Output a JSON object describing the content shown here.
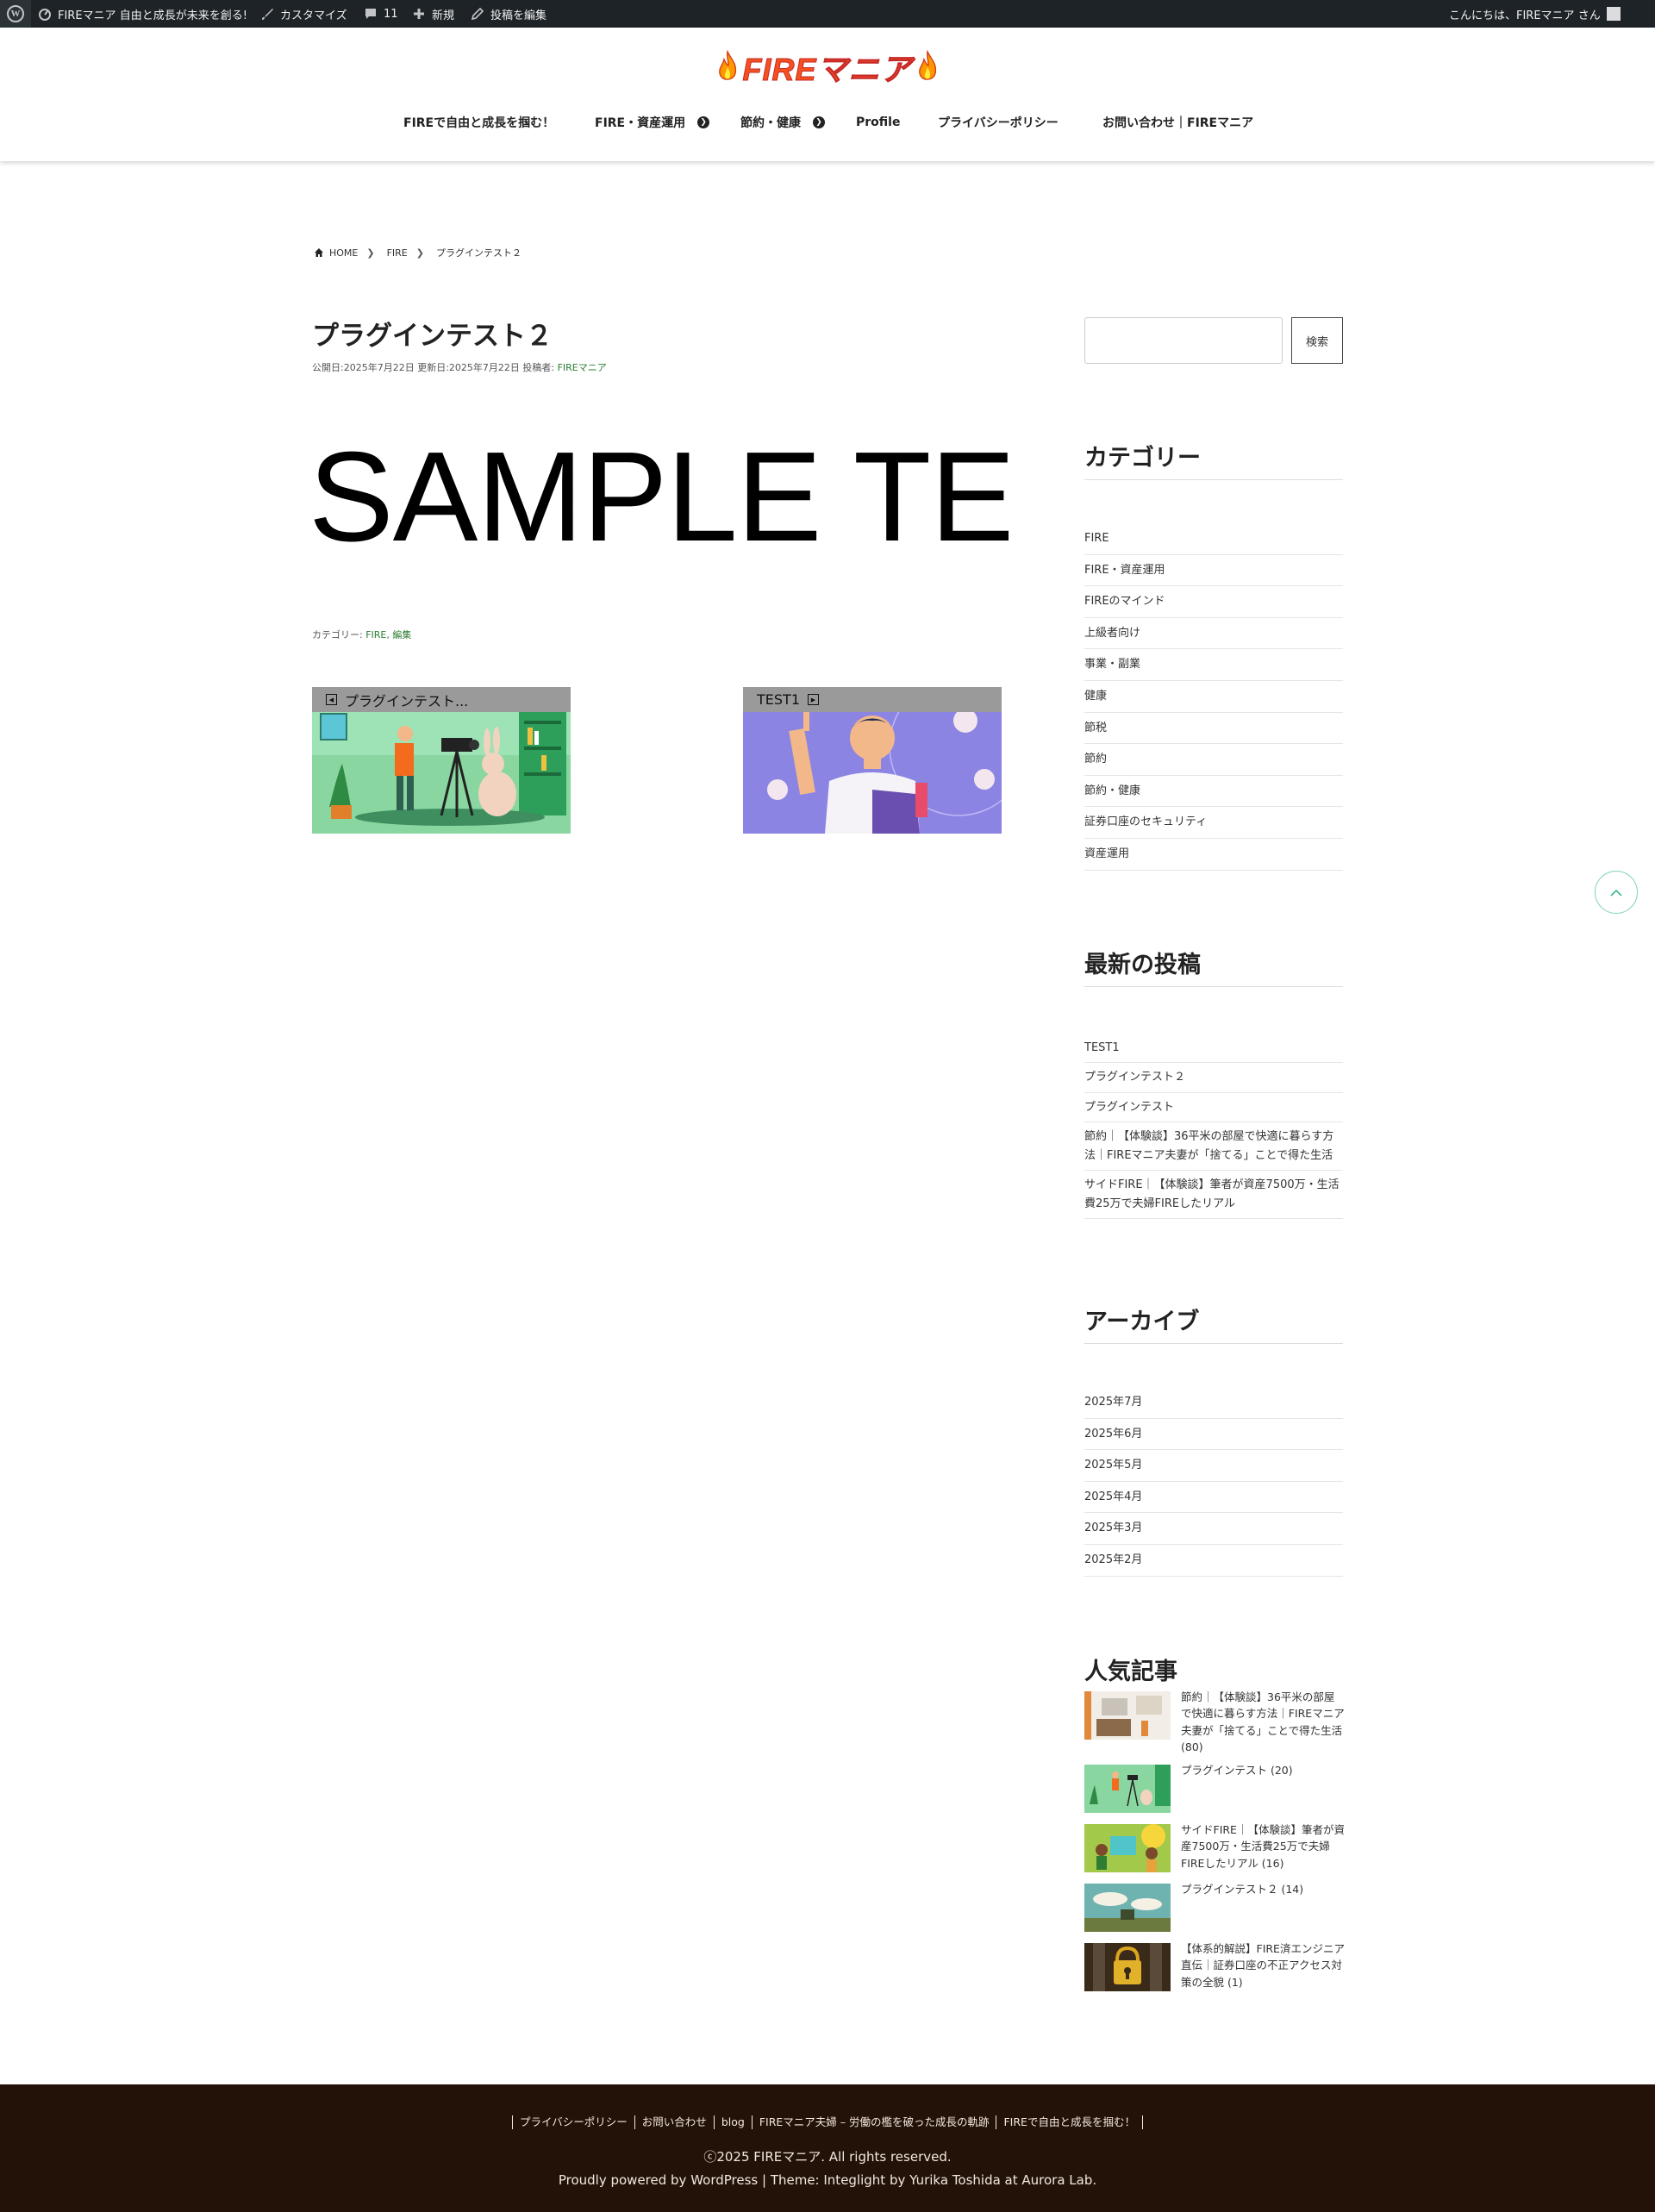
{
  "admin_bar": {
    "site_name": "FIREマニア 自由と成長が未来を創る!",
    "customize": "カスタマイズ",
    "comments_count": "11",
    "new": "新規",
    "edit_post": "投稿を編集",
    "greeting": "こんにちは、FIREマニア さん"
  },
  "header": {
    "logo_text": "FIREマニア",
    "nav": [
      {
        "label": "FIREで自由と成長を掴む！"
      },
      {
        "label": "FIRE・資産運用"
      },
      {
        "label": "節約・健康"
      },
      {
        "label": "Profile"
      },
      {
        "label": "プライバシーポリシー"
      },
      {
        "label": "お問い合わせ｜FIREマニア"
      }
    ]
  },
  "breadcrumb": {
    "home": "HOME",
    "category": "FIRE",
    "current": "プラグインテスト２"
  },
  "post": {
    "title": "プラグインテスト２",
    "meta_prefix": "公開日:2025年7月22日 更新日:2025年7月22日 投稿者: ",
    "author": "FIREマニア",
    "body_text": "SAMPLE TE",
    "categories_label": "カテゴリー: ",
    "categories": "FIRE, 編集"
  },
  "post_nav": {
    "prev_title": "プラグインテスト...",
    "next_title": "TEST1"
  },
  "sidebar": {
    "search_button": "検索",
    "search_value": "",
    "categories_title": "カテゴリー",
    "categories": [
      "FIRE",
      "FIRE・資産運用",
      "FIREのマインド",
      "上級者向け",
      "事業・副業",
      "健康",
      "節税",
      "節約",
      "節約・健康",
      "証券口座のセキュリティ",
      "資産運用"
    ],
    "recent_title": "最新の投稿",
    "recent": [
      "TEST1",
      "プラグインテスト２",
      "プラグインテスト",
      "節約｜【体験談】36平米の部屋で快適に暮らす方法｜FIREマニア夫妻が「捨てる」ことで得た生活",
      "サイドFIRE｜【体験談】筆者が資産7500万・生活費25万で夫婦FIREしたリアル"
    ],
    "archive_title": "アーカイブ",
    "archives": [
      "2025年7月",
      "2025年6月",
      "2025年5月",
      "2025年4月",
      "2025年3月",
      "2025年2月"
    ],
    "popular_title": "人気記事",
    "popular": [
      {
        "title": "節約｜【体験談】36平米の部屋で快適に暮らす方法｜FIREマニア夫妻が「捨てる」ことで得た生活 (80)"
      },
      {
        "title": "プラグインテスト (20)"
      },
      {
        "title": "サイドFIRE｜【体験談】筆者が資産7500万・生活費25万で夫婦FIREしたリアル (16)"
      },
      {
        "title": "プラグインテスト２ (14)"
      },
      {
        "title": "【体系的解説】FIRE済エンジニア直伝｜証券口座の不正アクセス対策の全貌 (1)"
      }
    ]
  },
  "footer": {
    "links": [
      "プライバシーポリシー",
      "お問い合わせ",
      "blog",
      "FIREマニア夫婦 – 労働の檻を破った成長の軌跡",
      "FIREで自由と成長を掴む！"
    ],
    "copyright": "ⓒ2025 FIREマニア. All rights reserved.",
    "powered": "Proudly powered by WordPress | Theme: Integlight by Yurika Toshida at Aurora Lab."
  },
  "colors": {
    "admin_bar": "#1d2327",
    "footer": "#231208",
    "accent_green": "#2e7d32",
    "logo_orange": "#f4511e"
  }
}
